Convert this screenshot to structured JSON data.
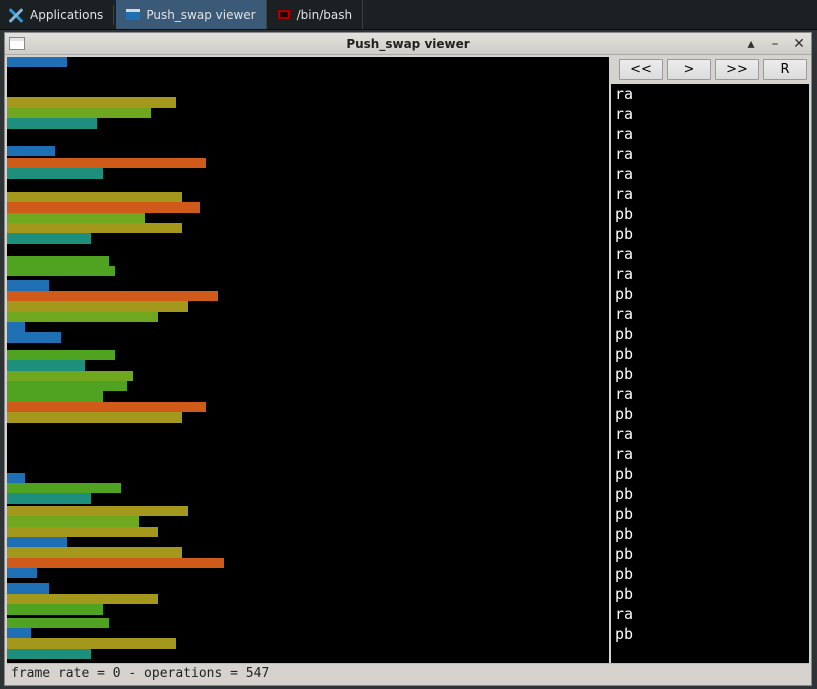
{
  "taskbar": {
    "applications_label": "Applications",
    "items": [
      {
        "label": "Push_swap viewer",
        "active": true,
        "icon": "win-icon"
      },
      {
        "label": "/bin/bash",
        "active": false,
        "icon": "term-icon"
      }
    ]
  },
  "window": {
    "title": "Push_swap viewer",
    "controls": {
      "rollup": "▴",
      "minimize": "–",
      "close": "✕"
    },
    "toolbar": {
      "back_label": "<<",
      "step_label": ">",
      "fwd_label": ">>",
      "reset_label": "R"
    },
    "status": "frame rate = 0 - operations = 547",
    "frame_rate": 0,
    "operations_count": 547
  },
  "chart_data": {
    "type": "bar",
    "orientation": "horizontal",
    "title": "",
    "xlabel": "",
    "ylabel": "",
    "xlim": [
      0,
      100
    ],
    "note": "Push_swap stack visualisation: each row is a value, bar width proportional to value, color bucketed by magnitude (blue=small → orange=large).",
    "bars": [
      {
        "w": 10,
        "fill": "#1f6fb5",
        "gap": 30
      },
      {
        "w": 28,
        "fill": "#a3981b",
        "gap": 0
      },
      {
        "w": 24,
        "fill": "#6fa81e"
      },
      {
        "w": 15,
        "fill": "#1f8f7d",
        "gap": 17
      },
      {
        "w": 8,
        "fill": "#1f6fb5",
        "gap": 2
      },
      {
        "w": 33,
        "fill": "#cf5a1a"
      },
      {
        "w": 16,
        "fill": "#1f8f7d",
        "gap": 13
      },
      {
        "w": 29,
        "fill": "#a3981b"
      },
      {
        "w": 32,
        "fill": "#cf5a1a"
      },
      {
        "w": 23,
        "fill": "#6fa81e"
      },
      {
        "w": 29,
        "fill": "#a3981b"
      },
      {
        "w": 14,
        "fill": "#1f8f7d",
        "gap": 12
      },
      {
        "w": 17,
        "fill": "#4fa321"
      },
      {
        "w": 18,
        "fill": "#4fa321",
        "gap": 4
      },
      {
        "w": 7,
        "fill": "#1f6fb5",
        "gap": 0
      },
      {
        "w": 35,
        "fill": "#cf5a1a"
      },
      {
        "w": 30,
        "fill": "#a3981b"
      },
      {
        "w": 25,
        "fill": "#6fa81e"
      },
      {
        "w": 3,
        "fill": "#1f6fb5"
      },
      {
        "w": 9,
        "fill": "#1f6fb5",
        "gap": 7
      },
      {
        "w": 18,
        "fill": "#4fa321"
      },
      {
        "w": 13,
        "fill": "#1f8f7d",
        "gap": 0
      },
      {
        "w": 21,
        "fill": "#6fa81e"
      },
      {
        "w": 20,
        "fill": "#4fa321"
      },
      {
        "w": 16,
        "fill": "#4fa321"
      },
      {
        "w": 33,
        "fill": "#cf5a1a"
      },
      {
        "w": 29,
        "fill": "#a3981b",
        "gap": 50
      },
      {
        "w": 3,
        "fill": "#1f6fb5"
      },
      {
        "w": 19,
        "fill": "#4fa321"
      },
      {
        "w": 14,
        "fill": "#1f8f7d",
        "gap": 2
      },
      {
        "w": 30,
        "fill": "#a3981b"
      },
      {
        "w": 22,
        "fill": "#6fa81e"
      },
      {
        "w": 25,
        "fill": "#a3981b"
      },
      {
        "w": 10,
        "fill": "#1f6fb5",
        "gap": 0
      },
      {
        "w": 29,
        "fill": "#a3981b"
      },
      {
        "w": 36,
        "fill": "#cf5a1a"
      },
      {
        "w": 5,
        "fill": "#1f6fb5",
        "gap": 5
      },
      {
        "w": 7,
        "fill": "#1f6fb5",
        "gap": 0
      },
      {
        "w": 25,
        "fill": "#a3981b"
      },
      {
        "w": 16,
        "fill": "#4fa321",
        "gap": 3
      },
      {
        "w": 17,
        "fill": "#4fa321"
      },
      {
        "w": 4,
        "fill": "#1f6fb5"
      },
      {
        "w": 28,
        "fill": "#a3981b"
      },
      {
        "w": 14,
        "fill": "#1f8f7d",
        "gap": 4
      }
    ]
  },
  "operations": [
    "ra",
    "ra",
    "ra",
    "ra",
    "ra",
    "ra",
    "pb",
    "pb",
    "ra",
    "ra",
    "pb",
    "ra",
    "pb",
    "pb",
    "pb",
    "ra",
    "pb",
    "ra",
    "ra",
    "pb",
    "pb",
    "pb",
    "pb",
    "pb",
    "pb",
    "pb",
    "ra",
    "pb"
  ]
}
